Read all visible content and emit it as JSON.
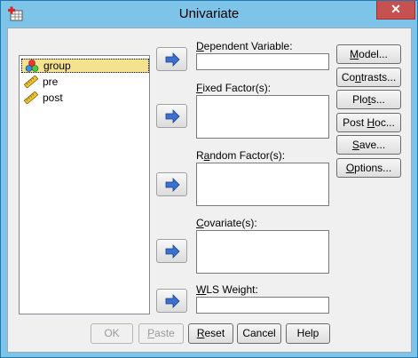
{
  "window": {
    "title": "Univariate",
    "close_glyph": "✕"
  },
  "variables": [
    {
      "name": "group",
      "type": "nominal",
      "icon": "nominal-icon",
      "selected": true
    },
    {
      "name": "pre",
      "type": "scale",
      "icon": "ruler-icon",
      "selected": false
    },
    {
      "name": "post",
      "type": "scale",
      "icon": "ruler-icon",
      "selected": false
    }
  ],
  "fields": {
    "dependent": {
      "mnemonic": "D",
      "rest": "ependent Variable:"
    },
    "fixed": {
      "pre": "",
      "mnemonic": "F",
      "rest": "ixed Factor(s):"
    },
    "random": {
      "pre": "R",
      "mnemonic": "a",
      "rest": "ndom Factor(s):"
    },
    "covariate": {
      "pre": "",
      "mnemonic": "C",
      "rest": "ovariate(s):"
    },
    "wls": {
      "pre": "",
      "mnemonic": "W",
      "rest": "LS Weight:"
    }
  },
  "side_buttons": {
    "model": {
      "pre": "",
      "mnemonic": "M",
      "rest": "odel..."
    },
    "contrasts": {
      "pre": "Co",
      "mnemonic": "n",
      "rest": "trasts..."
    },
    "plots": {
      "pre": "Plo",
      "mnemonic": "t",
      "rest": "s..."
    },
    "posthoc": {
      "pre": "Post ",
      "mnemonic": "H",
      "rest": "oc..."
    },
    "save": {
      "pre": "",
      "mnemonic": "S",
      "rest": "ave..."
    },
    "options": {
      "pre": "",
      "mnemonic": "O",
      "rest": "ptions..."
    }
  },
  "bottom_buttons": {
    "ok": {
      "label": "OK",
      "enabled": false
    },
    "paste": {
      "pre": "",
      "mnemonic": "P",
      "rest": "aste",
      "enabled": false
    },
    "reset": {
      "pre": "",
      "mnemonic": "R",
      "rest": "eset",
      "enabled": true
    },
    "cancel": {
      "label": "Cancel",
      "enabled": true
    },
    "help": {
      "label": "Help",
      "enabled": true
    }
  },
  "colors": {
    "selection": "#f5e28c",
    "arrow": "#3b6fd0",
    "close": "#c75050"
  }
}
